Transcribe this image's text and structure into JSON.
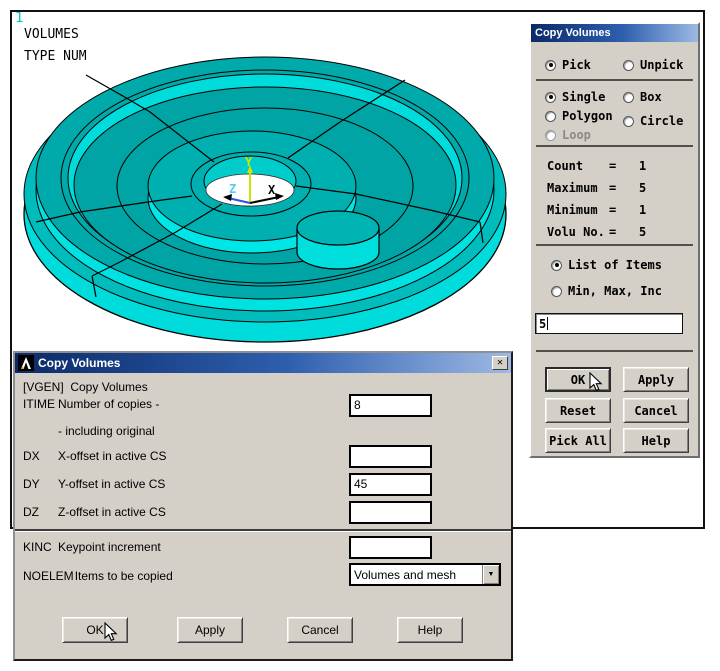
{
  "graphics": {
    "plot_number": "1",
    "legend": [
      "VOLUMES",
      "TYPE NUM"
    ],
    "triad": {
      "x": "X",
      "y": "Y",
      "z": "Z"
    },
    "colors": {
      "surface": "#00aaaa",
      "wall": "#00e2e2",
      "edge": "#000000",
      "background": "#ffffff"
    }
  },
  "pick_dialog": {
    "title": "Copy Volumes",
    "options": {
      "pick": "Pick",
      "unpick": "Unpick",
      "single": "Single",
      "box": "Box",
      "polygon": "Polygon",
      "circle": "Circle",
      "loop": "Loop",
      "list_of_items": "List of Items",
      "min_max_inc": "Min, Max, Inc"
    },
    "stats": [
      {
        "label": "Count",
        "eq": "=",
        "value": "1"
      },
      {
        "label": "Maximum",
        "eq": "=",
        "value": "5"
      },
      {
        "label": "Minimum",
        "eq": "=",
        "value": "1"
      },
      {
        "label": "Volu No.",
        "eq": "=",
        "value": "5"
      }
    ],
    "input_value": "5",
    "buttons": {
      "ok": "OK",
      "apply": "Apply",
      "reset": "Reset",
      "cancel": "Cancel",
      "pick_all": "Pick All",
      "help": "Help"
    }
  },
  "copy_dialog": {
    "title": "Copy Volumes",
    "command": "[VGEN]  Copy Volumes",
    "fields": {
      "itime": {
        "code": "ITIME",
        "desc": "Number of copies -",
        "value": "8"
      },
      "note": "- including original",
      "dx": {
        "code": "DX",
        "desc": "X-offset in active CS",
        "value": ""
      },
      "dy": {
        "code": "DY",
        "desc": "Y-offset in active CS",
        "value": "45"
      },
      "dz": {
        "code": "DZ",
        "desc": "Z-offset in active CS",
        "value": ""
      },
      "kinc": {
        "code": "KINC",
        "desc": "Keypoint increment",
        "value": ""
      },
      "noelem": {
        "code": "NOELEM",
        "desc": "Items to be copied",
        "value": "Volumes and mesh"
      }
    },
    "buttons": {
      "ok": "OK",
      "apply": "Apply",
      "cancel": "Cancel",
      "help": "Help"
    }
  }
}
